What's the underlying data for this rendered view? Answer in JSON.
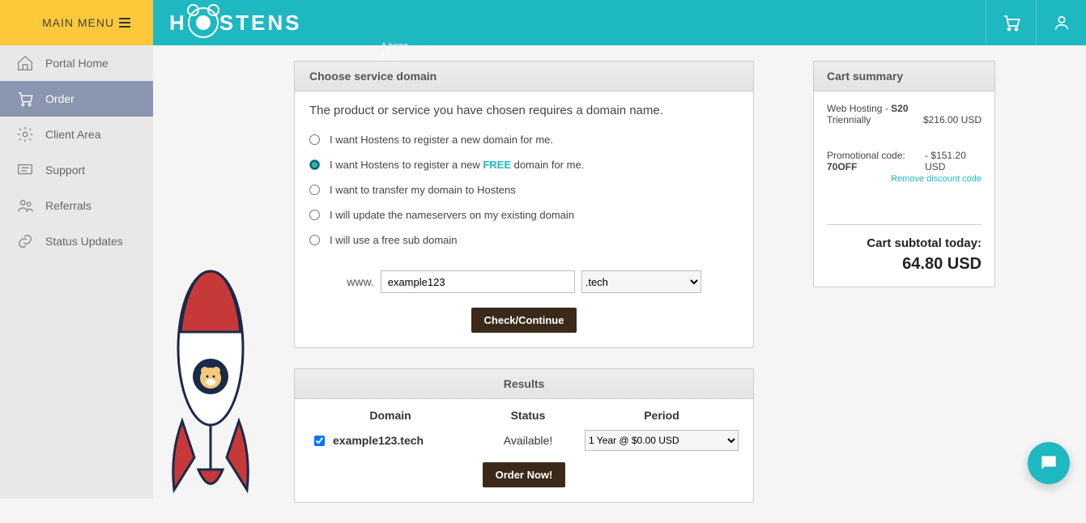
{
  "header": {
    "mainmenu": "MAIN MENU",
    "logo_tagline": "A home for your website"
  },
  "sidebar": {
    "items": [
      {
        "label": "Portal Home"
      },
      {
        "label": "Order"
      },
      {
        "label": "Client Area"
      },
      {
        "label": "Support"
      },
      {
        "label": "Referrals"
      },
      {
        "label": "Status Updates"
      }
    ]
  },
  "choose": {
    "heading": "Choose service domain",
    "desc": "The product or service you have chosen requires a domain name.",
    "opt1": "I want Hostens to register a new domain for me.",
    "opt2a": "I want Hostens to register a new ",
    "opt2_free": "FREE",
    "opt2b": " domain for me.",
    "opt3": "I want to transfer my domain to Hostens",
    "opt4": "I will update the nameservers on my existing domain",
    "opt5": "I will use a free sub domain",
    "www": "www.",
    "domain_value": "example123",
    "tld": ".tech",
    "check_btn": "Check/Continue"
  },
  "results": {
    "heading": "Results",
    "col_domain": "Domain",
    "col_status": "Status",
    "col_period": "Period",
    "domain": "example123.tech",
    "status": "Available!",
    "period": "1 Year @ $0.00 USD",
    "order_btn": "Order Now!"
  },
  "cart": {
    "heading": "Cart summary",
    "item_name": "Web Hosting - ",
    "item_plan": "S20",
    "item_term": "Triennially",
    "item_price": "$216.00 USD",
    "promo_label": "Promotional code: ",
    "promo_code": "70OFF",
    "promo_disc": "- $151.20 USD",
    "remove": "Remove discount code",
    "subtotal_label": "Cart subtotal today:",
    "subtotal": "64.80 USD"
  }
}
